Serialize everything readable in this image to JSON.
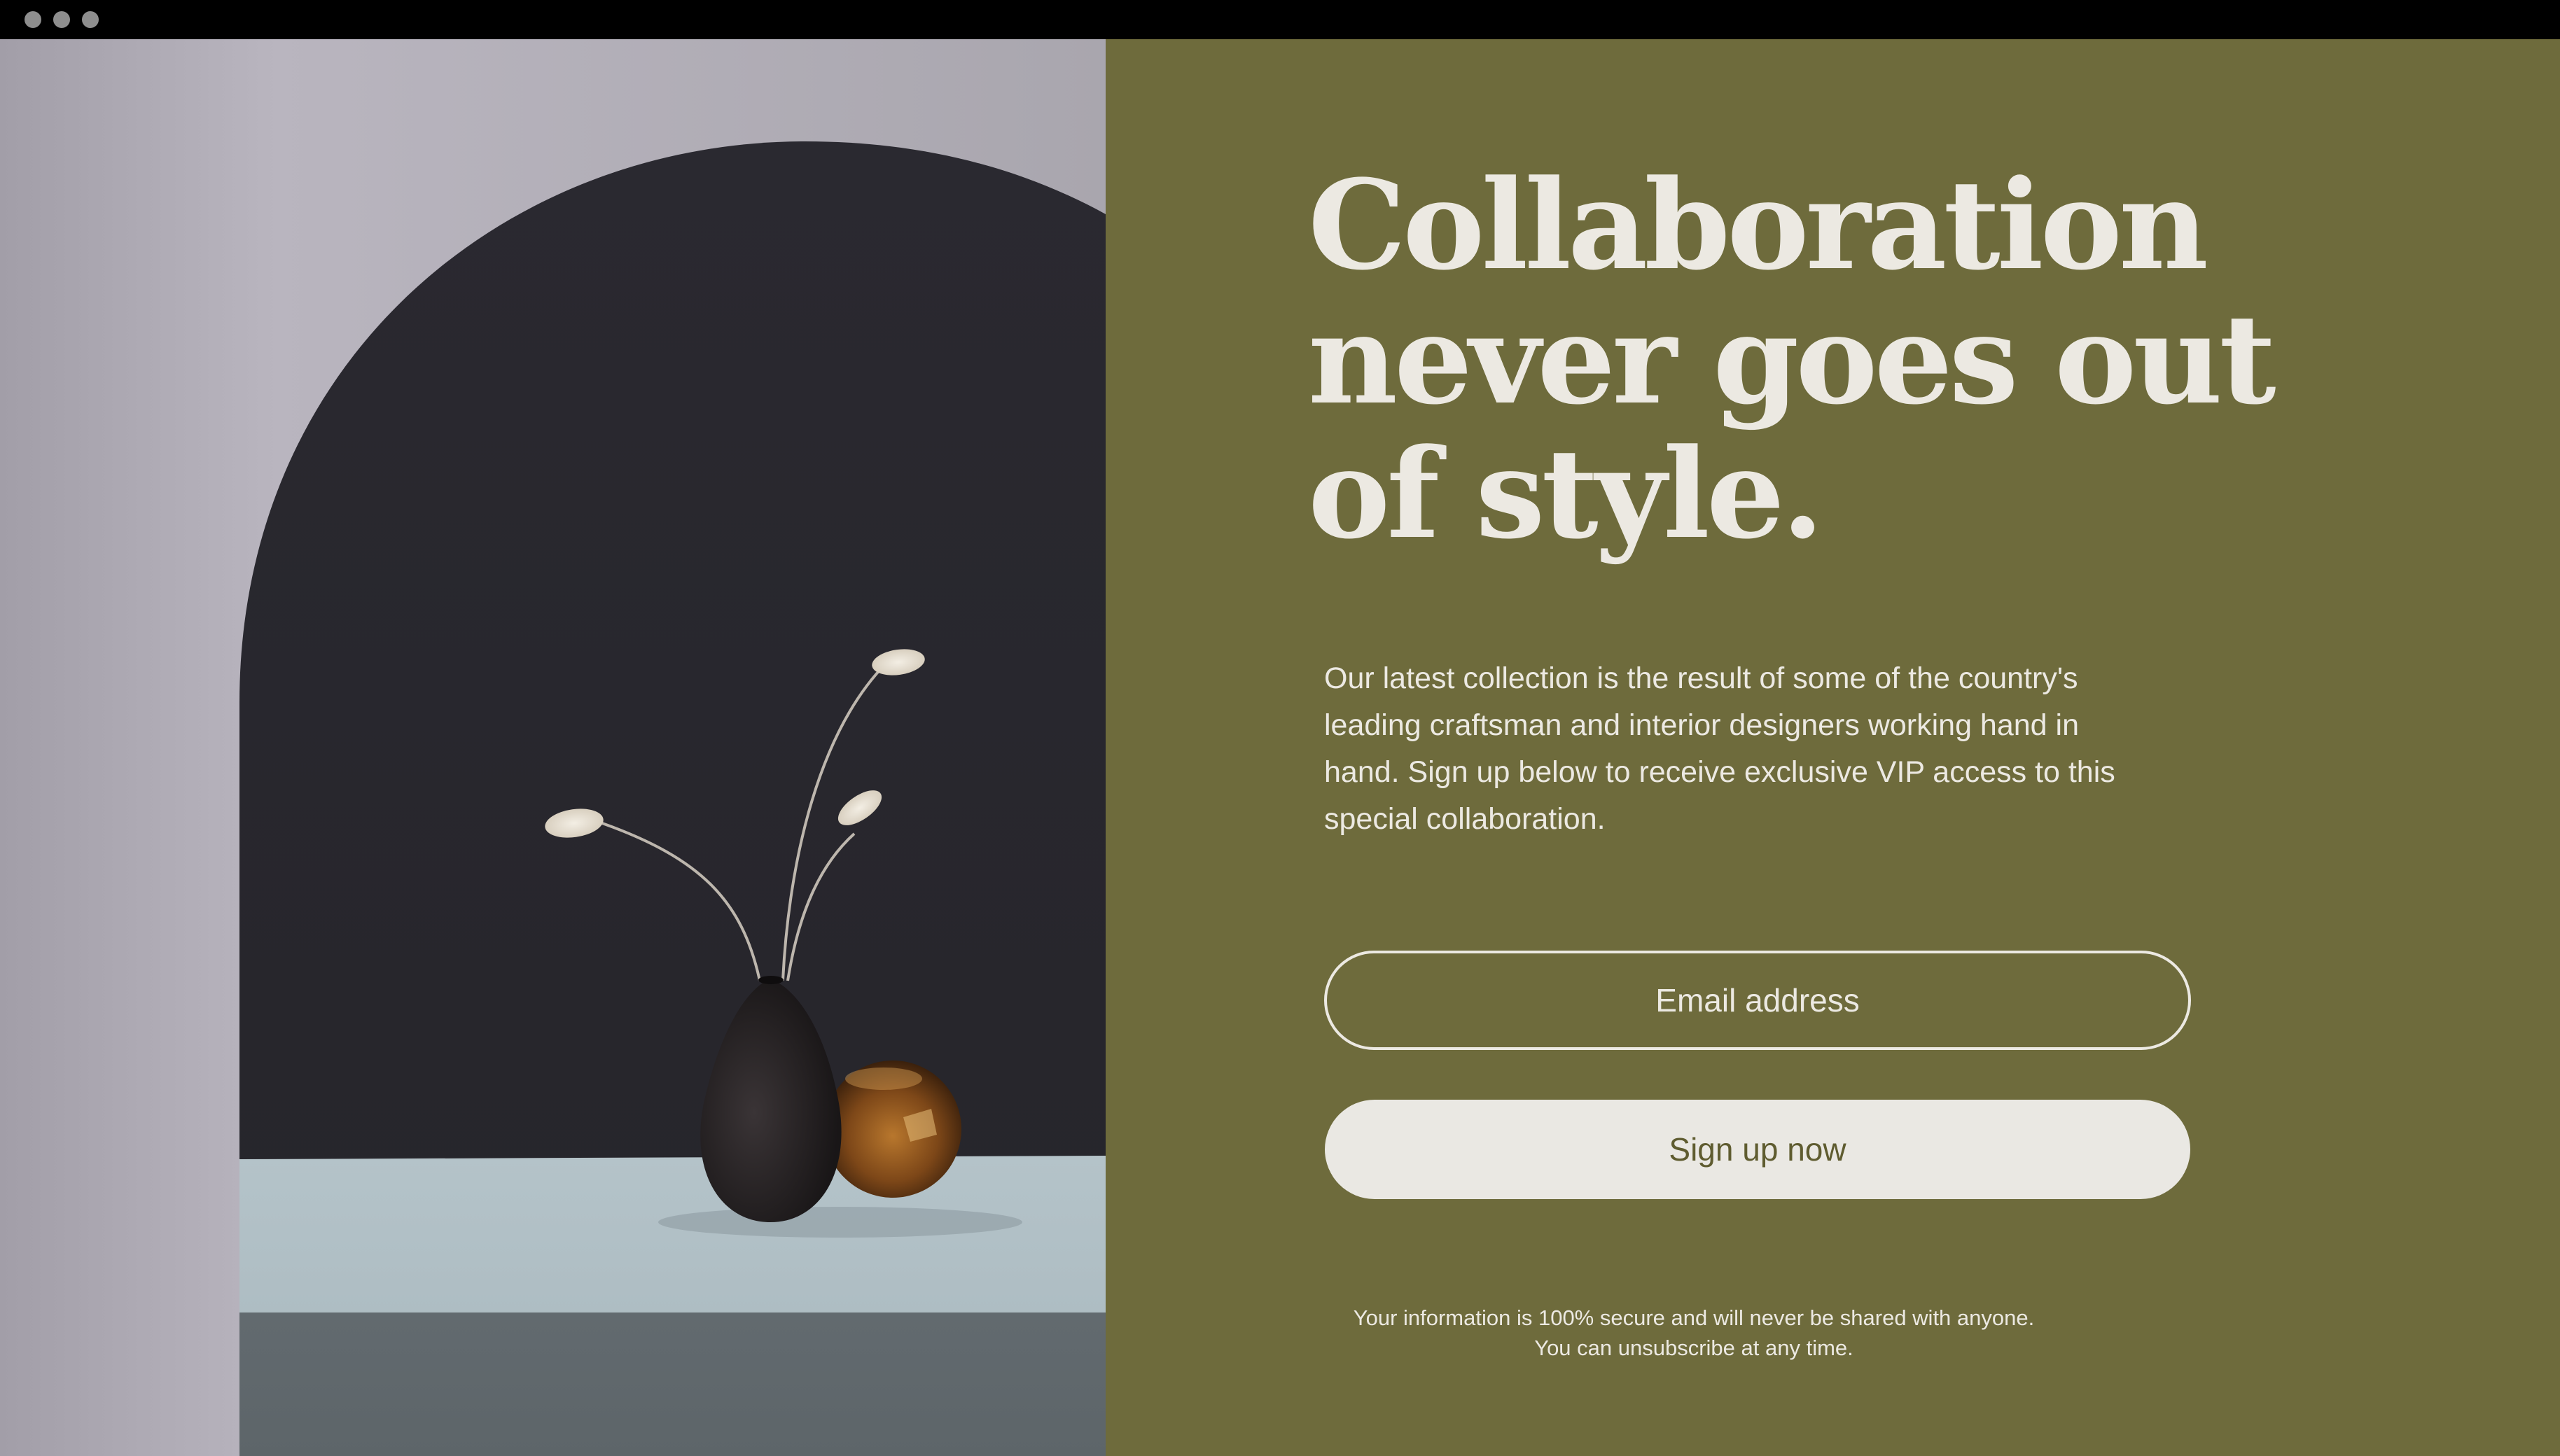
{
  "window": {
    "controls": [
      "close-dot",
      "minimize-dot",
      "maximize-dot"
    ]
  },
  "hero": {
    "headline_lines": [
      "Collaboration",
      "never goes out",
      "of style."
    ],
    "body_lines": [
      "Our latest collection is the result of some of the country's",
      "leading craftsman and interior designers working hand in",
      "hand. Sign up below to receive exclusive VIP access to this",
      "special collaboration."
    ]
  },
  "form": {
    "email_placeholder": "Email address",
    "email_value": "",
    "submit_label": "Sign up now",
    "disclaimer_lines": [
      "Your information is 100% secure and will never be shared with anyone.",
      "You can unsubscribe at any time."
    ]
  },
  "colors": {
    "panel_background": "#6e6b3c",
    "text_light": "#ece9e2",
    "button_background": "#eae8e3",
    "button_text": "#5f5c30",
    "chrome": "#000000"
  }
}
